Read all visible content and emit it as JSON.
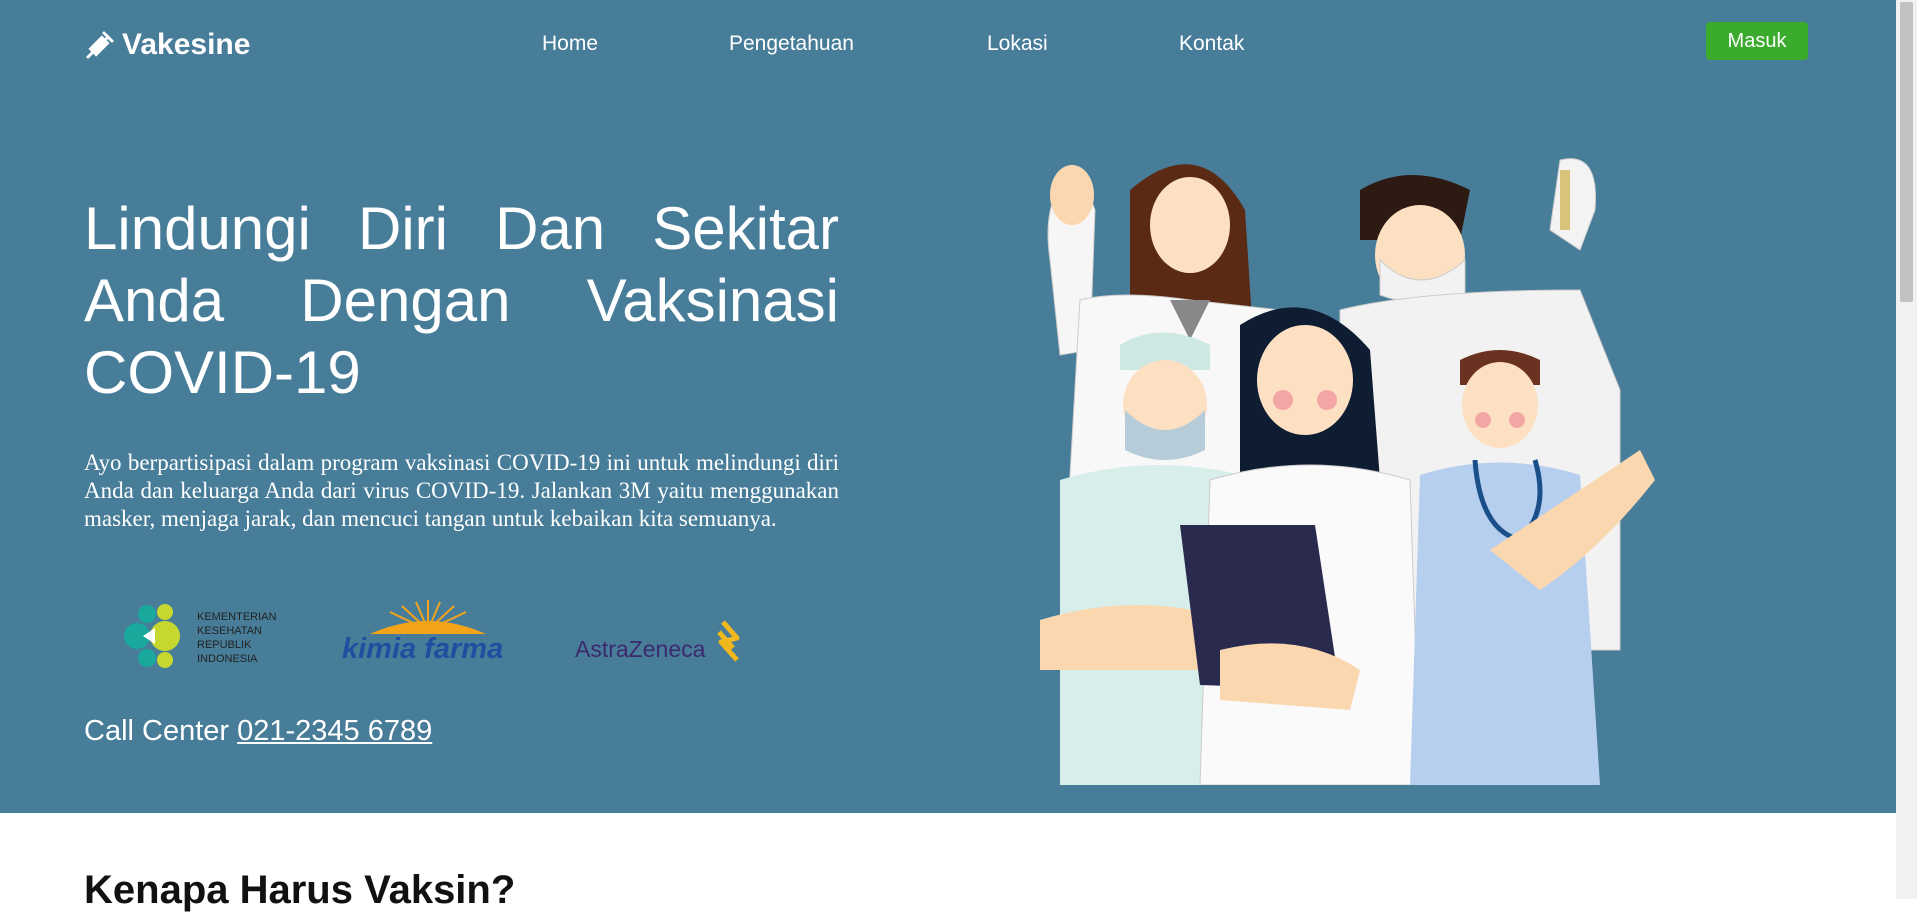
{
  "brand": {
    "name": "Vakesine"
  },
  "nav": {
    "items": [
      "Home",
      "Pengetahuan",
      "Lokasi",
      "Kontak"
    ]
  },
  "login": {
    "label": "Masuk"
  },
  "hero": {
    "title": "Lindungi Diri Dan Sekitar Anda Dengan Vaksinasi COVID-19",
    "description": "Ayo berpartisipasi dalam program vaksinasi COVID-19 ini untuk melindungi diri Anda dan keluarga Anda dari virus COVID-19. Jalankan 3M yaitu menggunakan masker, menjaga jarak, dan mencuci tangan untuk kebaikan kita semuanya.",
    "call_center_label": "Call Center",
    "call_center_number": "021-2345 6789"
  },
  "partners": {
    "kemenkes": {
      "line1": "KEMENTERIAN",
      "line2": "KESEHATAN",
      "line3": "REPUBLIK",
      "line4": "INDONESIA"
    },
    "kimia_farma": "kimia farma",
    "astrazeneca": "AstraZeneca"
  },
  "next_section": {
    "title": "Kenapa Harus Vaksin?"
  },
  "colors": {
    "hero_bg": "#477d98",
    "login_btn": "#3aab2c",
    "kimia_blue": "#1f4fa0",
    "kimia_orange": "#f3a41b",
    "astra_purple": "#3c2a6e",
    "astra_gold": "#f0b81c"
  },
  "icons": {
    "brand": "syringe-icon"
  }
}
